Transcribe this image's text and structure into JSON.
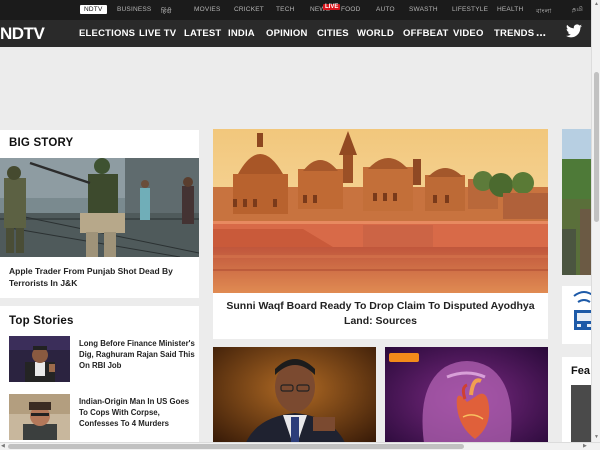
{
  "topbar": {
    "items": [
      "NDTV",
      "BUSINESS",
      "हिंदी",
      "MOVIES",
      "CRICKET",
      "TECH",
      "NEWS",
      "FOOD",
      "AUTO",
      "SWASTH",
      "LIFESTYLE",
      "HEALTH",
      "বাংলা",
      "தமி"
    ],
    "live_badge": "LIVE"
  },
  "mainbar": {
    "logo": "NDTV",
    "items": [
      "ELECTIONS",
      "LIVE TV",
      "LATEST",
      "INDIA",
      "OPINION",
      "CITIES",
      "WORLD",
      "OFFBEAT",
      "VIDEO",
      "TRENDS"
    ],
    "more": "...",
    "social_icon": "twitter-icon"
  },
  "big_story": {
    "title": "BIG STORY",
    "headline": "Apple Trader From Punjab Shot Dead By Terrorists In J&K"
  },
  "top_stories": {
    "title": "Top Stories",
    "items": [
      {
        "headline": "Long Before Finance Minister's Dig, Raghuram Rajan Said This On RBI Job"
      },
      {
        "headline": "Indian-Origin Man In US Goes To Cops With Corpse, Confesses To 4 Murders"
      }
    ]
  },
  "main_story": {
    "headline": "Sunni Waqf Board Ready To Drop Claim To Disputed Ayodhya Land: Sources"
  },
  "right_column": {
    "feature_label": "Fea"
  },
  "colors": {
    "topbar_bg": "#1b1b1b",
    "mainbar_bg": "#2a2a2a",
    "live_red": "#d8161d",
    "badge_orange": "#f28b1a",
    "page_bg": "#ececec"
  }
}
